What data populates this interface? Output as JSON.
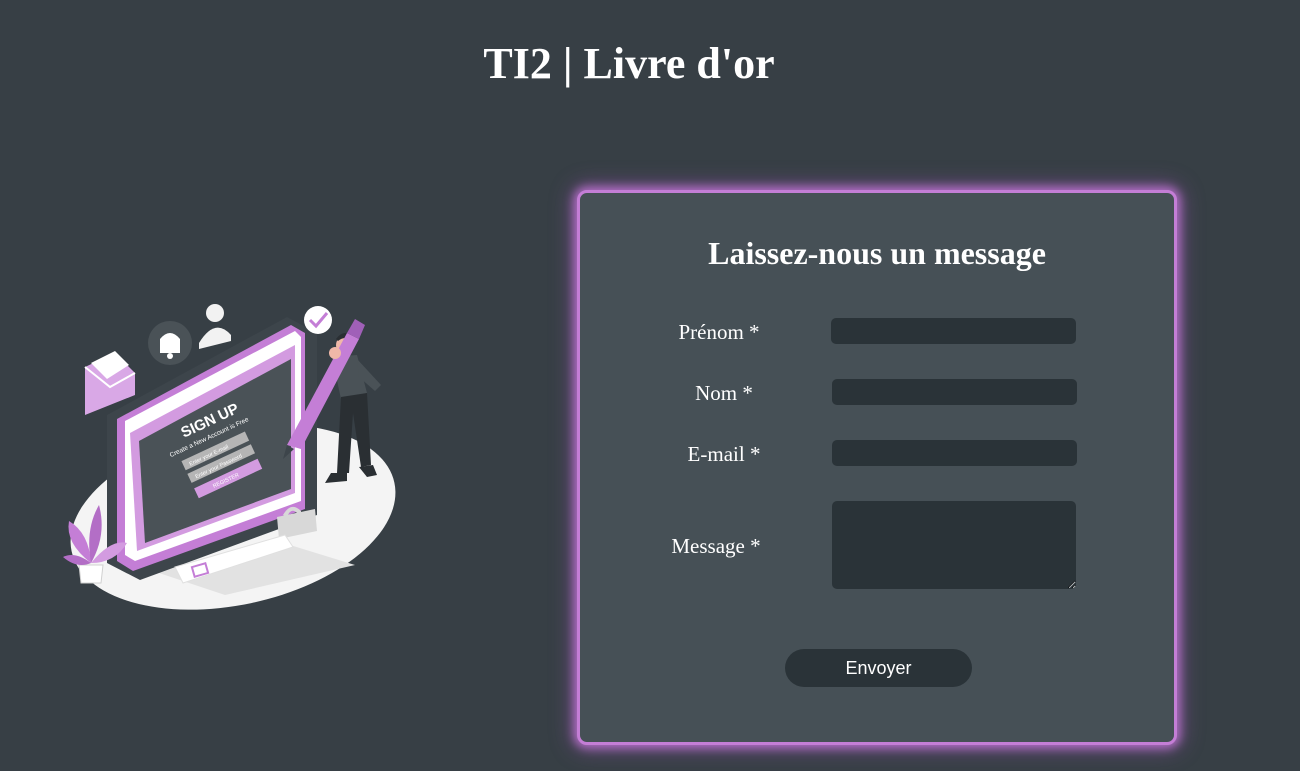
{
  "header": {
    "title": "TI2 | Livre d'or"
  },
  "illustration": {
    "heading": "SIGN UP",
    "subheading": "Create a New Account is Free",
    "email_placeholder": "Enter your E-mail",
    "password_placeholder": "Enter your Password",
    "register_label": "REGISTER"
  },
  "form": {
    "heading": "Laissez-nous un message",
    "fields": {
      "prenom": {
        "label": "Prénom *",
        "value": ""
      },
      "nom": {
        "label": "Nom *",
        "value": ""
      },
      "email": {
        "label": "E-mail *",
        "value": ""
      },
      "message": {
        "label": "Message *",
        "value": ""
      }
    },
    "submit_label": "Envoyer"
  },
  "colors": {
    "background": "#373f45",
    "card": "#465056",
    "accent": "#c47ed6",
    "input": "#2a3338",
    "text": "#ffffff"
  },
  "icons": [
    "envelope-icon",
    "bell-icon",
    "user-icon",
    "checkmark-icon",
    "pen-icon",
    "padlock-icon",
    "plant-icon"
  ]
}
